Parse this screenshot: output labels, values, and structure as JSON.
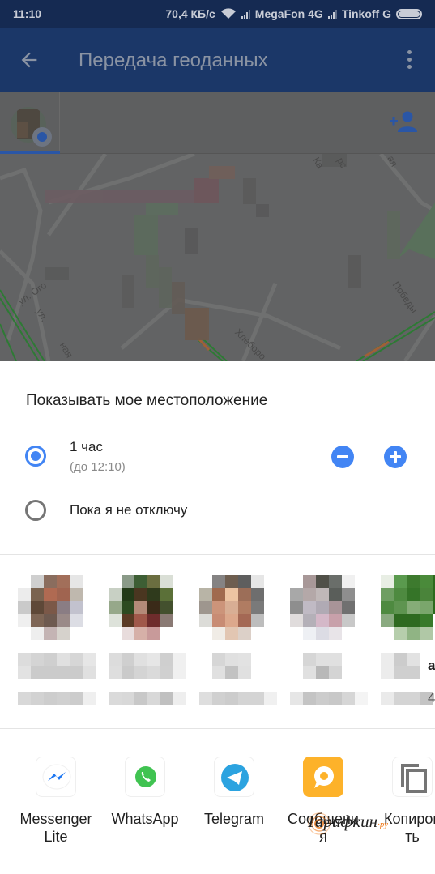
{
  "status_bar": {
    "time": "11:10",
    "speed": "70,4 КБ/с",
    "carrier1": "MegaFon 4G",
    "carrier2": "Tinkoff G",
    "icons": [
      "wifi-icon",
      "signal-icon",
      "signal-icon",
      "battery-icon"
    ]
  },
  "app_bar": {
    "title": "Передача геоданных",
    "back_icon": "arrow-left-icon",
    "menu_icon": "more-vert-icon",
    "color": "#1b3768"
  },
  "tabs": {
    "add_person_icon": "person-add-icon",
    "selected_tab": "own-avatar"
  },
  "map": {
    "labels": [
      "ул. Ого",
      "ул.",
      "ная",
      "Хлеборо",
      "Победы",
      "Ка",
      "рс",
      "ая"
    ]
  },
  "sheet": {
    "title": "Показывать мое местоположение",
    "options": [
      {
        "label": "1 час",
        "sublabel": "(до 12:10)",
        "selected": true
      },
      {
        "label": "Пока я не отключу",
        "selected": false
      }
    ],
    "decrease_icon": "minus-circle-icon",
    "increase_icon": "plus-circle-icon",
    "accent": "#4285f4"
  },
  "contacts": {
    "peek_name_char": "а",
    "peek_detail_char": "4"
  },
  "share_apps": [
    {
      "name": "Messenger Lite",
      "line1": "Messenger",
      "line2": "Lite",
      "icon": "messenger-lite-icon"
    },
    {
      "name": "WhatsApp",
      "line1": "WhatsApp",
      "line2": "",
      "icon": "whatsapp-icon"
    },
    {
      "name": "Telegram",
      "line1": "Telegram",
      "line2": "",
      "icon": "telegram-icon"
    },
    {
      "name": "Сообщения",
      "line1": "Сообщени",
      "line2": "я",
      "icon": "messages-icon"
    },
    {
      "name": "Копировать",
      "line1": "Копиров",
      "line2": "ть",
      "icon": "copy-icon"
    }
  ],
  "watermark": {
    "text": "Тарифкин",
    "suffix": "·ру"
  }
}
